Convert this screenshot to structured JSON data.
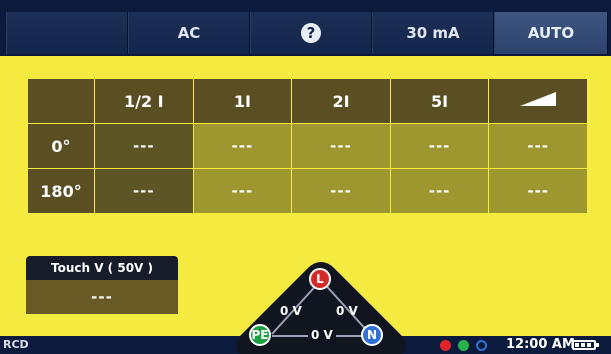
{
  "topbar": {
    "tabs": [
      {
        "label": ""
      },
      {
        "label": "AC"
      },
      {
        "label": "?"
      },
      {
        "label": "30 mA"
      },
      {
        "label": "AUTO"
      }
    ]
  },
  "table": {
    "headers": [
      "1/2 I",
      "1I",
      "2I",
      "5I",
      ""
    ],
    "rows": [
      {
        "label": "0°",
        "cells": [
          "---",
          "---",
          "---",
          "---",
          "---"
        ]
      },
      {
        "label": "180°",
        "cells": [
          "---",
          "---",
          "---",
          "---",
          "---"
        ]
      }
    ]
  },
  "touch": {
    "title": "Touch V ( 50V )",
    "value": "---"
  },
  "terminals": {
    "L": "L",
    "PE": "PE",
    "N": "N",
    "v_l_pe": "0 V",
    "v_l_n": "0 V",
    "v_pe_n": "0 V"
  },
  "status": {
    "mode": "RCD",
    "time": "12:00 AM"
  },
  "colors": {
    "background": "#0c1b3d",
    "work_area": "#f5ea3f",
    "dot_red": "#e1242c",
    "dot_green": "#27b34a",
    "dot_blue": "#2f6fd6"
  }
}
